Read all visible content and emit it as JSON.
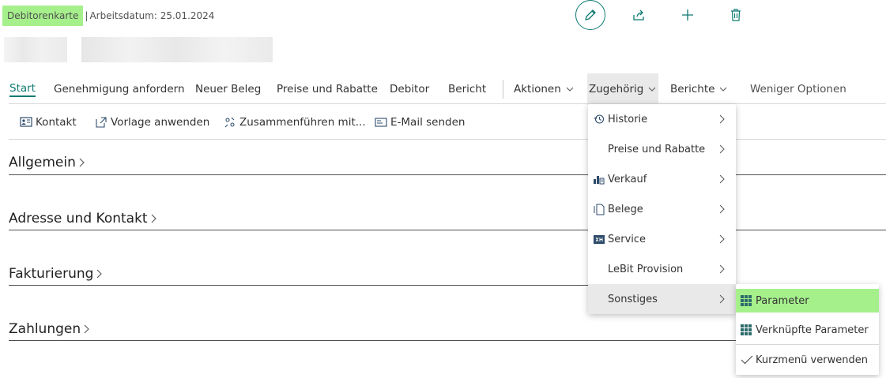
{
  "header": {
    "page_name": "Debitorenkarte",
    "separator": "|",
    "work_date": "Arbeitsdatum: 25.01.2024"
  },
  "top_actions": {
    "edit": "edit-icon",
    "share": "share-icon",
    "new": "plus-icon",
    "delete": "trash-icon"
  },
  "menu_bar": {
    "start": "Start",
    "request_approval": "Genehmigung anfordern",
    "new_document": "Neuer Beleg",
    "prices_discounts": "Preise und Rabatte",
    "customer": "Debitor",
    "report": "Bericht",
    "actions": "Aktionen",
    "related": "Zugehörig",
    "reports": "Berichte",
    "fewer_options": "Weniger Optionen"
  },
  "action_bar": {
    "contact": "Kontakt",
    "apply_template": "Vorlage anwenden",
    "merge_with": "Zusammenführen mit...",
    "send_email": "E-Mail senden"
  },
  "sections": {
    "general": "Allgemein",
    "address_contact": "Adresse und Kontakt",
    "invoicing": "Fakturierung",
    "payments": "Zahlungen"
  },
  "dropdown": {
    "items": [
      {
        "label": "Historie",
        "icon": "history-icon"
      },
      {
        "label": "Preise und Rabatte",
        "icon": ""
      },
      {
        "label": "Verkauf",
        "icon": "sales-icon"
      },
      {
        "label": "Belege",
        "icon": "document-icon"
      },
      {
        "label": "Service",
        "icon": "service-icon"
      },
      {
        "label": "LeBit Provision",
        "icon": ""
      },
      {
        "label": "Sonstiges",
        "icon": ""
      }
    ]
  },
  "submenu": {
    "items": [
      {
        "label": "Parameter",
        "icon": "grid-icon"
      },
      {
        "label": "Verknüpfte Parameter",
        "icon": "grid-icon"
      },
      {
        "label": "Kurzmenü verwenden",
        "icon": "checkmark-icon"
      }
    ]
  },
  "colors": {
    "accent": "#0e7a72",
    "highlight": "#a6f08c",
    "grid_icon": "#2d6a6a"
  }
}
